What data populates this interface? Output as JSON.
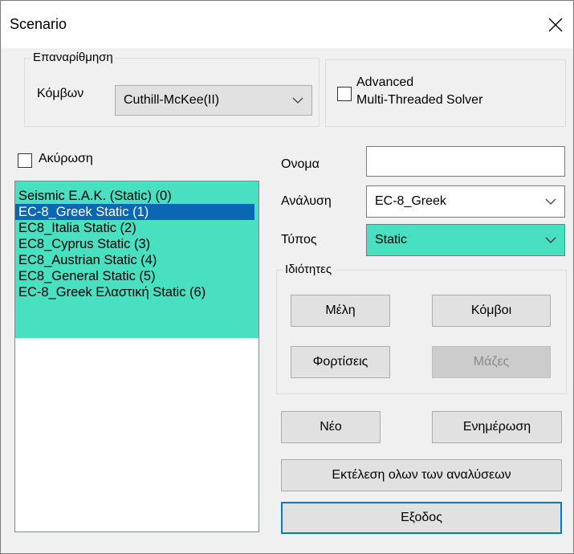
{
  "window": {
    "title": "Scenario"
  },
  "renumbering": {
    "legend": "Επαναρίθμηση",
    "nodes_label": "Κόμβων",
    "method": "Cuthill-McKee(II)"
  },
  "solver": {
    "line1": "Advanced",
    "line2": "Multi-Threaded Solver",
    "checked": false
  },
  "cancel": {
    "label": "Ακύρωση",
    "checked": false
  },
  "scenarios": {
    "items": [
      "Seismic E.A.K. (Static) (0)",
      "EC-8_Greek Static (1)",
      "EC8_Italia Static (2)",
      "EC8_Cyprus Static (3)",
      "EC8_Austrian Static (4)",
      "EC8_General Static (5)",
      "EC-8_Greek Ελαστική Static (6)"
    ],
    "selected_index": 1
  },
  "form": {
    "name_label": "Ονομα",
    "name_value": "",
    "analysis_label": "Ανάλυση",
    "analysis_value": "EC-8_Greek",
    "type_label": "Τύπος",
    "type_value": "Static"
  },
  "properties": {
    "legend": "Ιδιότητες",
    "members_button": "Μέλη",
    "nodes_button": "Κόμβοι",
    "loads_button": "Φορτίσεις",
    "masses_button": "Μάζες"
  },
  "actions": {
    "new_button": "Νέο",
    "update_button": "Ενημέρωση",
    "run_all_button": "Εκτέλεση ολων των αναλύσεων",
    "exit_button": "Εξοδος"
  },
  "colors": {
    "list_highlight": "#48e0c1",
    "selection": "#0a67b3",
    "default_button_border": "#0078d7"
  }
}
